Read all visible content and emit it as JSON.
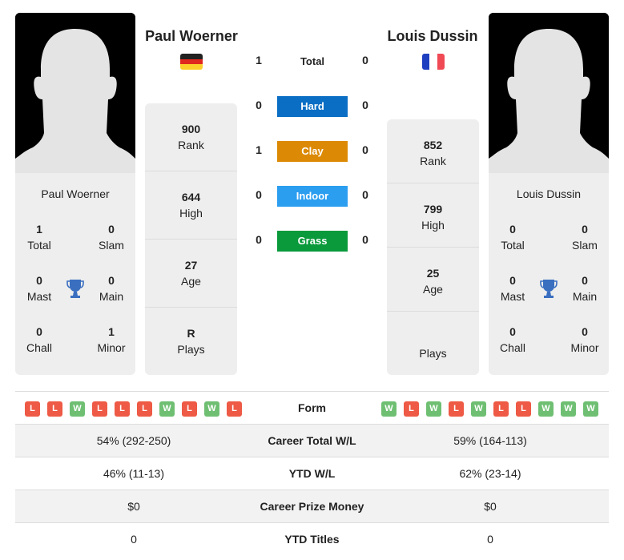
{
  "colors": {
    "hard": "#0a6ec4",
    "clay": "#dc8a06",
    "indoor": "#2b9ef0",
    "grass": "#0a9a3c",
    "win": "#6fbf73",
    "loss": "#ee5a45",
    "trophy": "#3a6fc0"
  },
  "player1": {
    "name": "Paul Woerner",
    "flag": "germany-flag",
    "titles": {
      "total": {
        "value": "1",
        "label": "Total"
      },
      "slam": {
        "value": "0",
        "label": "Slam"
      },
      "mast": {
        "value": "0",
        "label": "Mast"
      },
      "main": {
        "value": "0",
        "label": "Main"
      },
      "chall": {
        "value": "0",
        "label": "Chall"
      },
      "minor": {
        "value": "1",
        "label": "Minor"
      }
    },
    "info": {
      "rank": {
        "value": "900",
        "label": "Rank"
      },
      "high": {
        "value": "644",
        "label": "High"
      },
      "age": {
        "value": "27",
        "label": "Age"
      },
      "plays": {
        "value": "R",
        "label": "Plays"
      }
    },
    "form": [
      "L",
      "L",
      "W",
      "L",
      "L",
      "L",
      "W",
      "L",
      "W",
      "L"
    ],
    "career_wl": "54% (292-250)",
    "ytd_wl": "46% (11-13)",
    "prize_money": "$0",
    "ytd_titles": "0"
  },
  "player2": {
    "name": "Louis Dussin",
    "flag": "france-flag",
    "titles": {
      "total": {
        "value": "0",
        "label": "Total"
      },
      "slam": {
        "value": "0",
        "label": "Slam"
      },
      "mast": {
        "value": "0",
        "label": "Mast"
      },
      "main": {
        "value": "0",
        "label": "Main"
      },
      "chall": {
        "value": "0",
        "label": "Chall"
      },
      "minor": {
        "value": "0",
        "label": "Minor"
      }
    },
    "info": {
      "rank": {
        "value": "852",
        "label": "Rank"
      },
      "high": {
        "value": "799",
        "label": "High"
      },
      "age": {
        "value": "25",
        "label": "Age"
      },
      "plays": {
        "value": "",
        "label": "Plays"
      }
    },
    "form": [
      "W",
      "L",
      "W",
      "L",
      "W",
      "L",
      "L",
      "W",
      "W",
      "W"
    ],
    "career_wl": "59% (164-113)",
    "ytd_wl": "62% (23-14)",
    "prize_money": "$0",
    "ytd_titles": "0"
  },
  "h2h": {
    "total": {
      "label": "Total",
      "p1": "1",
      "p2": "0"
    },
    "hard": {
      "label": "Hard",
      "p1": "0",
      "p2": "0"
    },
    "clay": {
      "label": "Clay",
      "p1": "1",
      "p2": "0"
    },
    "indoor": {
      "label": "Indoor",
      "p1": "0",
      "p2": "0"
    },
    "grass": {
      "label": "Grass",
      "p1": "0",
      "p2": "0"
    }
  },
  "table": {
    "form_label": "Form",
    "career_wl_label": "Career Total W/L",
    "ytd_wl_label": "YTD W/L",
    "prize_label": "Career Prize Money",
    "ytd_titles_label": "YTD Titles"
  }
}
